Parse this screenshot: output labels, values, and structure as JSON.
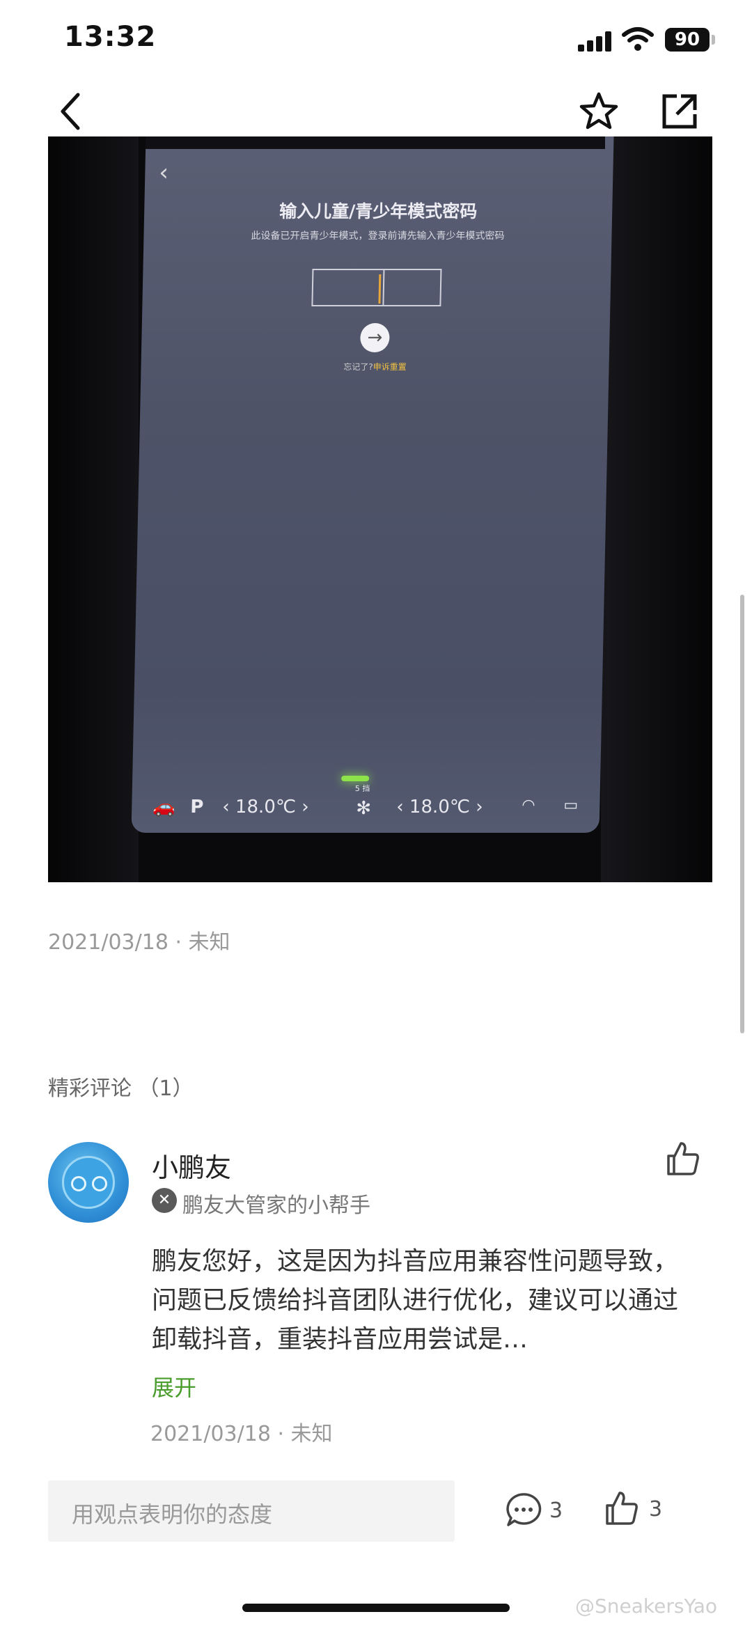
{
  "status_bar": {
    "time": "13:32",
    "battery": "90"
  },
  "photo_screen": {
    "back_glyph": "‹",
    "title": "输入儿童/青少年模式密码",
    "subtitle": "此设备已开启青少年模式，登录前请先输入青少年模式密码",
    "go_glyph": "→",
    "forgot_prefix": "忘记了?",
    "forgot_link": "申诉重置",
    "temp_left": "‹ 18.0℃ ›",
    "fan_label": "5 挡",
    "temp_right": "‹ 18.0℃ ›"
  },
  "post": {
    "date": "2021/03/18 · 未知"
  },
  "comments_section": {
    "title": "精彩评论 （1）",
    "items": [
      {
        "name": "小鹏友",
        "badge": "鹏友大管家的小帮手",
        "text": "鹏友您好，这是因为抖音应用兼容性问题导致，问题已反馈给抖音团队进行优化，建议可以通过卸载抖音，重装抖音应用尝试是…",
        "expand": "展开",
        "date": "2021/03/18 · 未知"
      }
    ]
  },
  "bottom_bar": {
    "input_placeholder": "用观点表明你的态度",
    "comment_count": "3",
    "like_count": "3"
  },
  "watermark": "@SneakersYao",
  "colors": {
    "accent_green": "#4a9d2c"
  }
}
